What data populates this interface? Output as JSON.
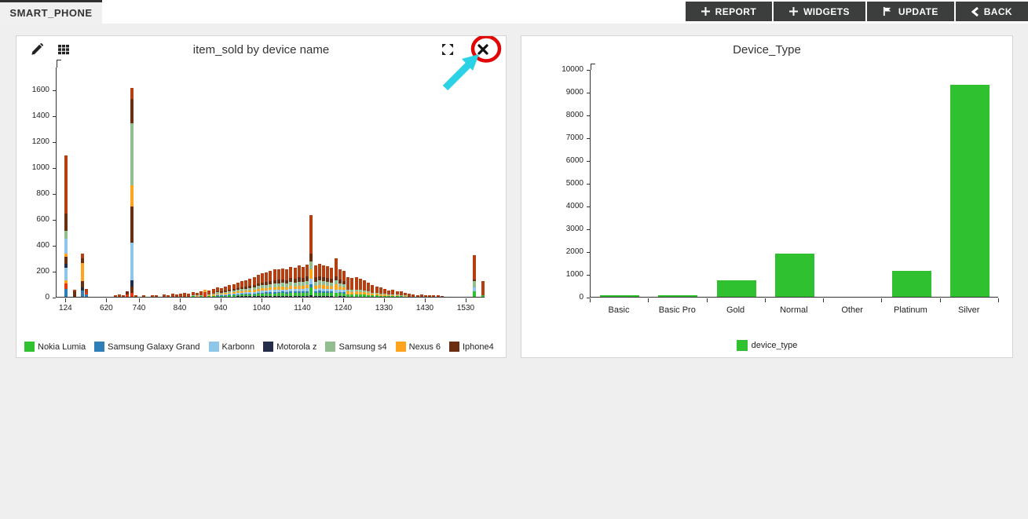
{
  "tab_label": "SMART_PHONE",
  "toolbar": {
    "report": "REPORT",
    "widgets": "WIDGETS",
    "update": "UPDATE",
    "back": "BACK"
  },
  "left_widget": {
    "title": "item_sold by device name"
  },
  "right_widget": {
    "title": "Device_Type"
  },
  "annotation": {
    "circle_color": "#e10505",
    "arrow_color": "#2bd2e5"
  },
  "chart_data": [
    {
      "type": "bar",
      "stacked": true,
      "title": "item_sold by device name",
      "xlabel": "device name",
      "ylabel": "item_sold",
      "ylim": [
        0,
        1600
      ],
      "yticks": [
        0,
        200,
        400,
        600,
        800,
        1000,
        1200,
        1400,
        1600
      ],
      "x_ticks": [
        [
          2,
          "124"
        ],
        [
          12,
          "620"
        ],
        [
          20,
          "740"
        ],
        [
          30,
          "840"
        ],
        [
          40,
          "940"
        ],
        [
          50,
          "1040"
        ],
        [
          60,
          "1140"
        ],
        [
          70,
          "1240"
        ],
        [
          80,
          "1330"
        ],
        [
          90,
          "1430"
        ],
        [
          100,
          "1530"
        ]
      ],
      "slot_count": 106,
      "legend_position": "bottom",
      "grid": false,
      "series_legend": [
        {
          "name": "Nokia Lumia",
          "color": "#2fc12f"
        },
        {
          "name": "Samsung Galaxy Grand",
          "color": "#2e7eb8"
        },
        {
          "name": "Karbonn",
          "color": "#8ec6ea"
        },
        {
          "name": "Motorola z",
          "color": "#232d49"
        },
        {
          "name": "Samsung s4",
          "color": "#92bd8e"
        },
        {
          "name": "Nexus 6",
          "color": "#ffa41c"
        },
        {
          "name": "Iphone4",
          "color": "#6b2e12"
        }
      ],
      "palette": {
        "green": "#2fc12f",
        "blue": "#2e7eb8",
        "lightblue": "#8ec6ea",
        "navy": "#232d49",
        "sage": "#92bd8e",
        "orange": "#ffa41c",
        "brown": "#6b2e12",
        "rust": "#b33f12",
        "red": "#e8380d"
      },
      "profiles": {
        "mix": [
          [
            "navy",
            0.03
          ],
          [
            "green",
            0.1
          ],
          [
            "blue",
            0.05
          ],
          [
            "lightblue",
            0.08
          ],
          [
            "orange",
            0.1
          ],
          [
            "sage",
            0.13
          ],
          [
            "brown",
            0.13
          ],
          [
            "rust",
            0.38
          ]
        ],
        "mixS": [
          [
            "green",
            0.12
          ],
          [
            "orange",
            0.15
          ],
          [
            "sage",
            0.1
          ],
          [
            "rust",
            0.63
          ]
        ],
        "rust": [
          [
            "rust",
            1
          ]
        ]
      },
      "custom_segments": {
        "A": [
          [
            "blue",
            60
          ],
          [
            "red",
            45
          ],
          [
            "orange",
            20
          ],
          [
            "lightblue",
            100
          ],
          [
            "navy",
            30
          ],
          [
            "brown",
            55
          ],
          [
            "orange",
            25
          ],
          [
            "lightblue",
            115
          ],
          [
            "sage",
            60
          ],
          [
            "brown",
            135
          ],
          [
            "rust",
            445
          ]
        ],
        "B4": [
          [
            "brown",
            40
          ],
          [
            "rust",
            15
          ]
        ],
        "B": [
          [
            "blue",
            50
          ],
          [
            "navy",
            25
          ],
          [
            "brown",
            45
          ],
          [
            "orange",
            140
          ],
          [
            "brown",
            40
          ],
          [
            "rust",
            35
          ]
        ],
        "C": [
          [
            "blue",
            20
          ],
          [
            "red",
            12
          ],
          [
            "rust",
            28
          ]
        ],
        "D17": [
          [
            "red",
            20
          ],
          [
            "brown",
            25
          ]
        ],
        "D": [
          [
            "red",
            30
          ],
          [
            "brown",
            50
          ],
          [
            "navy",
            50
          ],
          [
            "lightblue",
            290
          ],
          [
            "brown",
            280
          ],
          [
            "orange",
            160
          ],
          [
            "sage",
            480
          ],
          [
            "brown",
            190
          ],
          [
            "rust",
            80
          ]
        ],
        "E36": [
          [
            "red",
            35
          ],
          [
            "orange",
            20
          ]
        ],
        "F": [
          [
            "navy",
            15
          ],
          [
            "green",
            55
          ],
          [
            "blue",
            25
          ],
          [
            "lightblue",
            45
          ],
          [
            "orange",
            70
          ],
          [
            "sage",
            65
          ],
          [
            "brown",
            60
          ],
          [
            "rust",
            295
          ]
        ],
        "G": [
          [
            "green",
            30
          ],
          [
            "lightblue",
            25
          ],
          [
            "orange",
            40
          ],
          [
            "sage",
            30
          ],
          [
            "brown",
            35
          ],
          [
            "rust",
            140
          ]
        ],
        "H": [
          [
            "green",
            45
          ],
          [
            "lightblue",
            25
          ],
          [
            "sage",
            50
          ],
          [
            "brown",
            15
          ],
          [
            "rust",
            185
          ]
        ],
        "I": [
          [
            "green",
            12
          ],
          [
            "rust",
            108
          ]
        ]
      },
      "bars": [
        [
          2,
          1090,
          "A"
        ],
        [
          4,
          55,
          "B4"
        ],
        [
          6,
          335,
          "B"
        ],
        [
          7,
          60,
          "C"
        ],
        [
          14,
          12,
          "rust"
        ],
        [
          15,
          18,
          "rust"
        ],
        [
          16,
          10,
          "rust"
        ],
        [
          17,
          45,
          "D17"
        ],
        [
          18,
          1610,
          "D"
        ],
        [
          19,
          15,
          "rust"
        ],
        [
          21,
          10,
          "rust"
        ],
        [
          23,
          15,
          "rust"
        ],
        [
          24,
          10,
          "rust"
        ],
        [
          26,
          20,
          "rust"
        ],
        [
          27,
          15,
          "rust"
        ],
        [
          28,
          25,
          "rust"
        ],
        [
          29,
          20,
          "rust"
        ],
        [
          30,
          25,
          "rust"
        ],
        [
          31,
          30,
          "rust"
        ],
        [
          32,
          25,
          "rust"
        ],
        [
          33,
          35,
          "mixS"
        ],
        [
          34,
          30,
          "mixS"
        ],
        [
          35,
          40,
          "mixS"
        ],
        [
          36,
          55,
          "E36"
        ],
        [
          37,
          50,
          "mixS"
        ],
        [
          38,
          60,
          "mixS"
        ],
        [
          39,
          70,
          "mix"
        ],
        [
          40,
          65,
          "mix"
        ],
        [
          41,
          80,
          "mix"
        ],
        [
          42,
          90,
          "mix"
        ],
        [
          43,
          100,
          "mix"
        ],
        [
          44,
          110,
          "mix"
        ],
        [
          45,
          120,
          "mix"
        ],
        [
          46,
          130,
          "mix"
        ],
        [
          47,
          140,
          "mix"
        ],
        [
          48,
          150,
          "mix"
        ],
        [
          49,
          170,
          "mix"
        ],
        [
          50,
          180,
          "mix"
        ],
        [
          51,
          190,
          "mix"
        ],
        [
          52,
          200,
          "mix"
        ],
        [
          53,
          210,
          "mix"
        ],
        [
          54,
          215,
          "mix"
        ],
        [
          55,
          220,
          "mix"
        ],
        [
          56,
          210,
          "mix"
        ],
        [
          57,
          230,
          "mix"
        ],
        [
          58,
          225,
          "mix"
        ],
        [
          59,
          240,
          "mix"
        ],
        [
          60,
          230,
          "mix"
        ],
        [
          61,
          250,
          "mix"
        ],
        [
          62,
          630,
          "F"
        ],
        [
          63,
          240,
          "mix"
        ],
        [
          64,
          255,
          "mix"
        ],
        [
          65,
          245,
          "mix"
        ],
        [
          66,
          235,
          "mix"
        ],
        [
          67,
          225,
          "mix"
        ],
        [
          68,
          300,
          "G"
        ],
        [
          69,
          215,
          "mix"
        ],
        [
          70,
          200,
          "mix"
        ],
        [
          71,
          150,
          "mixS"
        ],
        [
          72,
          145,
          "mixS"
        ],
        [
          73,
          150,
          "mixS"
        ],
        [
          74,
          140,
          "mixS"
        ],
        [
          75,
          130,
          "mixS"
        ],
        [
          76,
          110,
          "mixS"
        ],
        [
          77,
          90,
          "mixS"
        ],
        [
          78,
          80,
          "mixS"
        ],
        [
          79,
          70,
          "mixS"
        ],
        [
          80,
          60,
          "mixS"
        ],
        [
          81,
          50,
          "mixS"
        ],
        [
          82,
          55,
          "mixS"
        ],
        [
          83,
          45,
          "mixS"
        ],
        [
          84,
          40,
          "mixS"
        ],
        [
          85,
          30,
          "mixS"
        ],
        [
          86,
          25,
          "rust"
        ],
        [
          87,
          20,
          "rust"
        ],
        [
          88,
          15,
          "rust"
        ],
        [
          89,
          20,
          "rust"
        ],
        [
          90,
          15,
          "rust"
        ],
        [
          91,
          10,
          "rust"
        ],
        [
          92,
          12,
          "rust"
        ],
        [
          93,
          10,
          "rust"
        ],
        [
          94,
          8,
          "rust"
        ],
        [
          102,
          320,
          "H"
        ],
        [
          104,
          120,
          "I"
        ]
      ]
    },
    {
      "type": "bar",
      "title": "Device_Type",
      "categories": [
        "Basic",
        "Basic Pro",
        "Gold",
        "Normal",
        "Other",
        "Platinum",
        "Silver"
      ],
      "values": [
        80,
        85,
        730,
        1900,
        0,
        1150,
        9300
      ],
      "bar_color": "#2fc12f",
      "ylim": [
        0,
        10000
      ],
      "yticks": [
        0,
        1000,
        2000,
        3000,
        4000,
        5000,
        6000,
        7000,
        8000,
        9000,
        10000
      ],
      "grid": false,
      "legend_position": "bottom",
      "legend": [
        {
          "label": "device_type",
          "color": "#2fc12f"
        }
      ]
    }
  ]
}
